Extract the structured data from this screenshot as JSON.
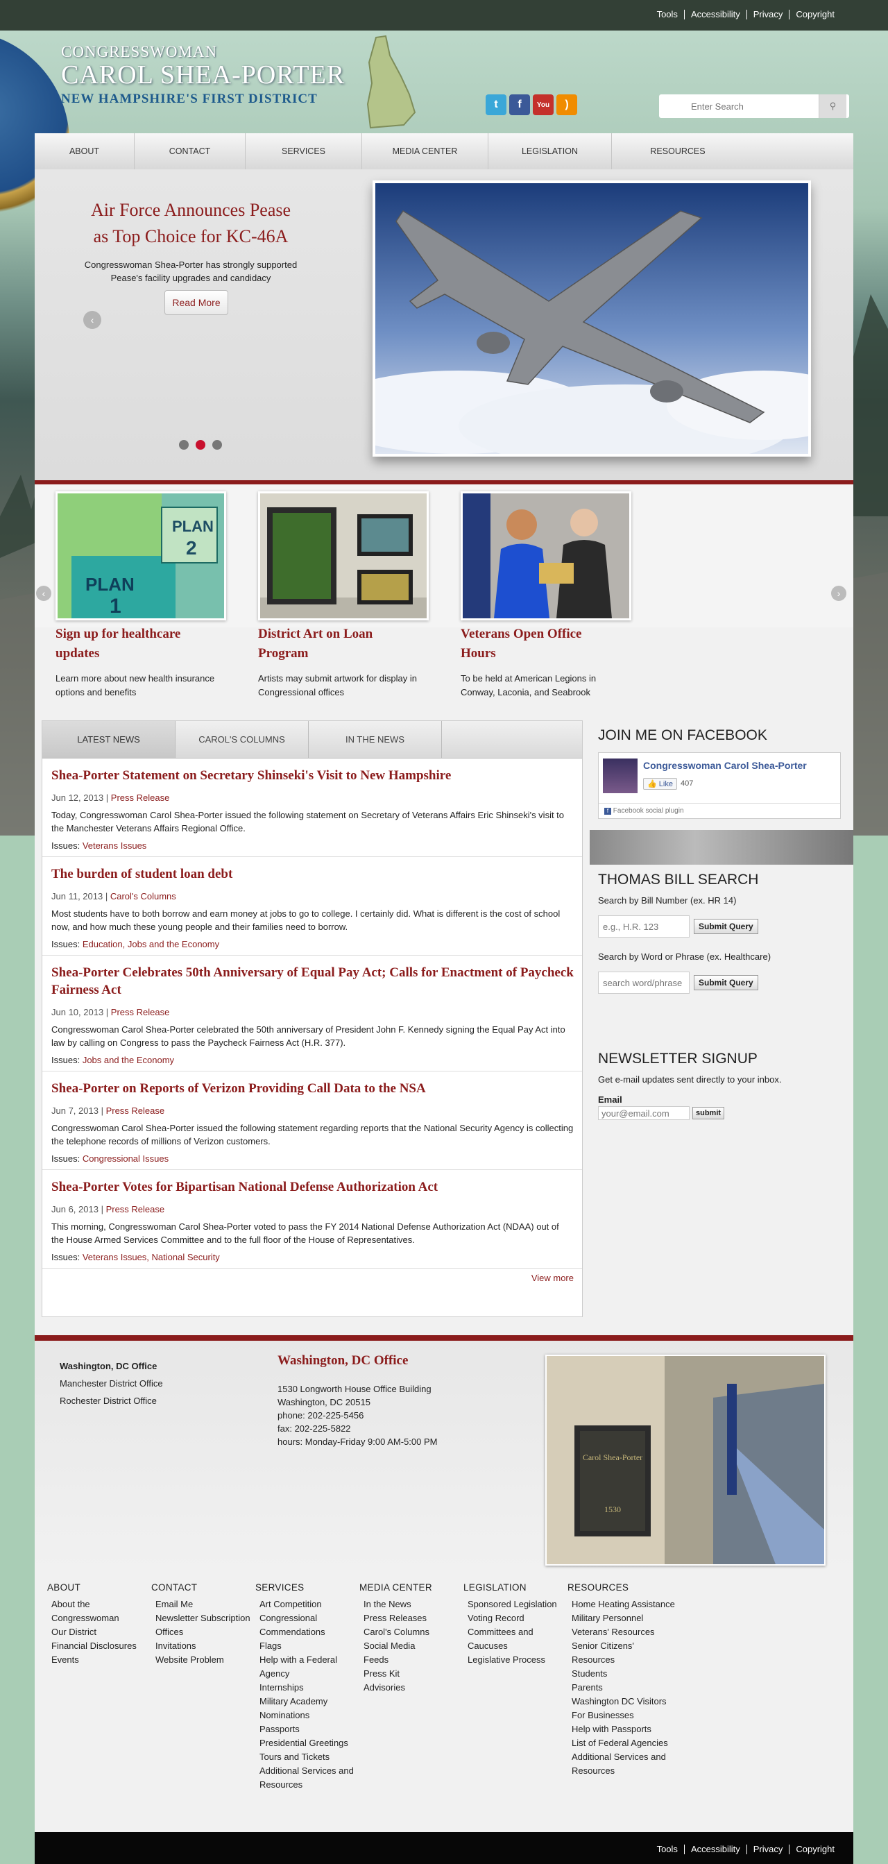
{
  "utility_links": [
    "Tools",
    "Accessibility",
    "Privacy",
    "Copyright"
  ],
  "header": {
    "line1": "CONGRESSWOMAN",
    "line2": "CAROL SHEA-PORTER",
    "line3": "NEW HAMPSHIRE'S FIRST DISTRICT",
    "search_placeholder": "Enter Search",
    "social": [
      "twitter-icon",
      "facebook-icon",
      "youtube-icon",
      "rss-icon"
    ]
  },
  "nav": [
    "ABOUT",
    "CONTACT",
    "SERVICES",
    "MEDIA CENTER",
    "LEGISLATION",
    "RESOURCES"
  ],
  "slider": {
    "title_line1": "Air Force Announces Pease",
    "title_line2": "as Top Choice for KC-46A",
    "text_line1": "Congresswoman Shea-Porter has strongly supported",
    "text_line2": "Pease's facility upgrades and candidacy",
    "button": "Read More",
    "active_dot": 2
  },
  "features": [
    {
      "title1": "Sign up for healthcare",
      "title2": "updates",
      "text1": "Learn more about new health insurance",
      "text2": "options and benefits",
      "plan_a": "PLAN",
      "plan_a_num": "1",
      "plan_b": "PLAN",
      "plan_b_num": "2"
    },
    {
      "title1": "District Art on Loan",
      "title2": "Program",
      "text1": "Artists may submit artwork for display in",
      "text2": "Congressional offices"
    },
    {
      "title1": "Veterans Open Office",
      "title2": "Hours",
      "text1": "To be held at American Legions in",
      "text2": "Conway, Laconia, and Seabrook"
    }
  ],
  "tabs": [
    "LATEST NEWS",
    "CAROL'S COLUMNS",
    "IN THE NEWS"
  ],
  "articles": [
    {
      "title": "Shea-Porter Statement on Secretary Shinseki's Visit to New Hampshire",
      "date": "Jun 12, 2013",
      "type": "Press Release",
      "body": "Today, Congresswoman Carol Shea-Porter issued the following statement on Secretary of Veterans Affairs Eric Shinseki's visit to the Manchester Veterans Affairs Regional Office.",
      "issues_label": "Issues:",
      "issues": "Veterans Issues"
    },
    {
      "title": "The burden of student loan debt",
      "date": "Jun 11, 2013",
      "type": "Carol's Columns",
      "body": "Most students have to both borrow and earn money at jobs to go to college. I certainly did. What is different is the cost of school now, and how much these young people and their families need to borrow.",
      "issues_label": "Issues:",
      "issues": "Education, Jobs and the Economy"
    },
    {
      "title": "Shea-Porter Celebrates 50th Anniversary of Equal Pay Act; Calls for Enactment of Paycheck Fairness Act",
      "date": "Jun 10, 2013",
      "type": "Press Release",
      "body": "Congresswoman Carol Shea-Porter celebrated the 50th anniversary of President John F. Kennedy signing the Equal Pay Act into law by calling on Congress to pass the Paycheck Fairness Act (H.R. 377).",
      "issues_label": "Issues:",
      "issues": "Jobs and the Economy"
    },
    {
      "title": "Shea-Porter on Reports of Verizon Providing Call Data to the NSA",
      "date": "Jun 7, 2013",
      "type": "Press Release",
      "body": "Congresswoman Carol Shea-Porter issued the following statement regarding reports that the National Security Agency is collecting the telephone records of millions of Verizon customers.",
      "issues_label": "Issues:",
      "issues": "Congressional Issues"
    },
    {
      "title": "Shea-Porter Votes for Bipartisan National Defense Authorization Act",
      "date": "Jun 6, 2013",
      "type": "Press Release",
      "body": "This morning, Congresswoman Carol Shea-Porter voted to pass the FY 2014 National Defense Authorization Act (NDAA) out of the House Armed Services Committee and to the full floor of the House of Representatives.",
      "issues_label": "Issues:",
      "issues": "Veterans Issues, National Security"
    }
  ],
  "view_more": "View more",
  "facebook": {
    "heading": "JOIN ME ON FACEBOOK",
    "page_name": "Congresswoman Carol Shea-Porter",
    "like": "Like",
    "likes": "407",
    "plugin": "Facebook social plugin"
  },
  "thomas": {
    "heading": "THOMAS BILL SEARCH",
    "label1": "Search by Bill Number (ex. HR 14)",
    "placeholder1": "e.g., H.R. 123",
    "label2": "Search by Word or Phrase (ex. Healthcare)",
    "placeholder2": "search word/phrase",
    "submit": "Submit Query"
  },
  "newsletter": {
    "heading": "NEWSLETTER SIGNUP",
    "text": "Get e-mail updates sent directly to your inbox.",
    "email_label": "Email",
    "placeholder": "your@email.com",
    "submit": "submit"
  },
  "offices": [
    "Washington, DC Office",
    "Manchester District Office",
    "Rochester District Office"
  ],
  "office_detail": {
    "title": "Washington, DC Office",
    "lines": [
      "1530 Longworth House Office Building",
      "Washington, DC 20515",
      "phone: 202-225-5456",
      "fax: 202-225-5822",
      "hours: Monday-Friday 9:00 AM-5:00 PM"
    ],
    "nameplate1": "Carol Shea-Porter",
    "nameplate2": "1530"
  },
  "sitemap": [
    {
      "heading": "ABOUT",
      "items": [
        "About the Congresswoman",
        "Our District",
        "Financial Disclosures",
        "Events"
      ]
    },
    {
      "heading": "CONTACT",
      "items": [
        "Email Me",
        "Newsletter Subscription",
        "Offices",
        "Invitations",
        "Website Problem"
      ]
    },
    {
      "heading": "SERVICES",
      "items": [
        "Art Competition",
        "Congressional Commendations",
        "Flags",
        "Help with a Federal Agency",
        "Internships",
        "Military Academy Nominations",
        "Passports",
        "Presidential Greetings",
        "Tours and Tickets",
        "Additional Services and Resources"
      ]
    },
    {
      "heading": "MEDIA CENTER",
      "items": [
        "In the News",
        "Press Releases",
        "Carol's Columns",
        "Social Media",
        "Feeds",
        "Press Kit",
        "Advisories"
      ]
    },
    {
      "heading": "LEGISLATION",
      "items": [
        "Sponsored Legislation",
        "Voting Record",
        "Committees and Caucuses",
        "Legislative Process"
      ]
    },
    {
      "heading": "RESOURCES",
      "items": [
        "Home Heating Assistance",
        "Military Personnel",
        "Veterans' Resources",
        "Senior Citizens' Resources",
        "Students",
        "Parents",
        "Washington DC Visitors",
        "For Businesses",
        "Help with Passports",
        "List of Federal Agencies",
        "Additional Services and Resources"
      ]
    }
  ],
  "colors": {
    "accent": "#8b1c1c",
    "topbar": "#334036",
    "bottombar": "#070707",
    "active_dot": "#c8102e"
  }
}
